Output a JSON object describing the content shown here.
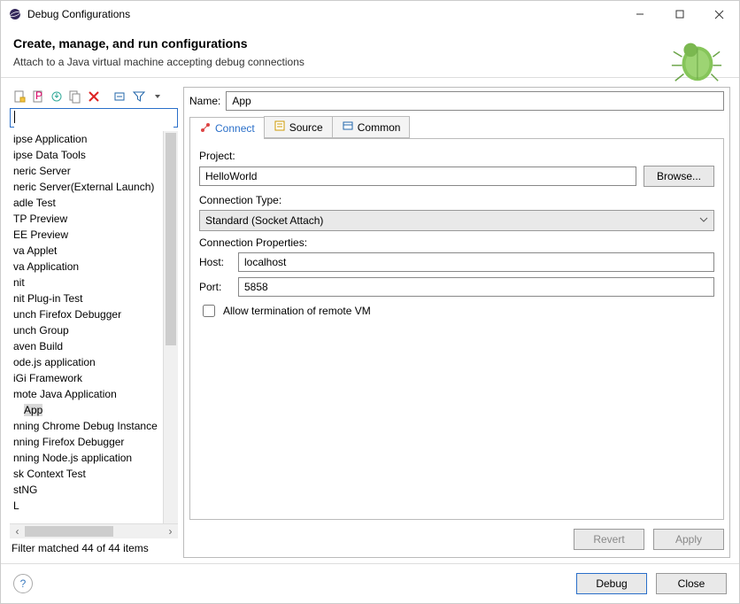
{
  "window": {
    "title": "Debug Configurations"
  },
  "header": {
    "heading": "Create, manage, and run configurations",
    "subheading": "Attach to a Java virtual machine accepting debug connections"
  },
  "toolbar_icons": [
    "new-config",
    "new-prototype",
    "export",
    "duplicate",
    "delete",
    "collapse-all",
    "filter",
    "filter-menu"
  ],
  "filter_input": {
    "value": ""
  },
  "tree": {
    "items": [
      {
        "label": "ipse Application"
      },
      {
        "label": "ipse Data Tools"
      },
      {
        "label": "neric Server"
      },
      {
        "label": "neric Server(External Launch)"
      },
      {
        "label": "adle Test"
      },
      {
        "label": "TP Preview"
      },
      {
        "label": "EE Preview"
      },
      {
        "label": "va Applet"
      },
      {
        "label": "va Application"
      },
      {
        "label": "nit"
      },
      {
        "label": "nit Plug-in Test"
      },
      {
        "label": "unch Firefox Debugger"
      },
      {
        "label": "unch Group"
      },
      {
        "label": "aven Build"
      },
      {
        "label": "ode.js application"
      },
      {
        "label": "iGi Framework"
      },
      {
        "label": "mote Java Application"
      },
      {
        "label": "App",
        "selected": true,
        "child": true
      },
      {
        "label": "nning Chrome Debug Instance"
      },
      {
        "label": "nning Firefox Debugger"
      },
      {
        "label": "nning Node.js application"
      },
      {
        "label": "sk Context Test"
      },
      {
        "label": "stNG"
      },
      {
        "label": "L"
      }
    ]
  },
  "status_text": "Filter matched 44 of 44 items",
  "form": {
    "name_label": "Name:",
    "name_value": "App",
    "tabs": [
      {
        "id": "connect",
        "label": "Connect",
        "active": true
      },
      {
        "id": "source",
        "label": "Source",
        "active": false
      },
      {
        "id": "common",
        "label": "Common",
        "active": false
      }
    ],
    "project_label": "Project:",
    "project_value": "HelloWorld",
    "browse_label": "Browse...",
    "conn_type_label": "Connection Type:",
    "conn_type_value": "Standard (Socket Attach)",
    "conn_props_label": "Connection Properties:",
    "host_label": "Host:",
    "host_value": "localhost",
    "port_label": "Port:",
    "port_value": "5858",
    "allow_term_label": "Allow termination of remote VM",
    "allow_term_checked": false,
    "revert_label": "Revert",
    "apply_label": "Apply"
  },
  "footer": {
    "debug_label": "Debug",
    "close_label": "Close"
  }
}
